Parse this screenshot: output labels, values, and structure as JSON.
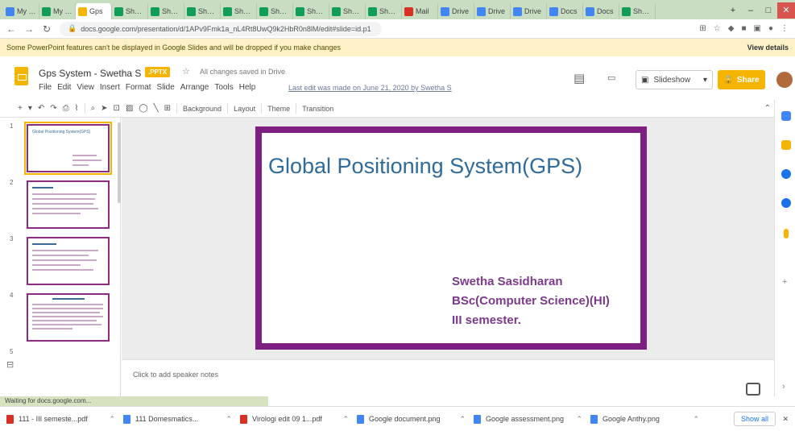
{
  "browser": {
    "tabs": [
      {
        "label": "My Drive",
        "color": "#4285f4"
      },
      {
        "label": "My Drive",
        "color": "#0f9d58"
      },
      {
        "label": "Gps",
        "color": "#f4b400",
        "active": true
      },
      {
        "label": "Sheets",
        "color": "#0f9d58"
      },
      {
        "label": "Sheets",
        "color": "#0f9d58"
      },
      {
        "label": "Sheets",
        "color": "#0f9d58"
      },
      {
        "label": "Sheets",
        "color": "#0f9d58"
      },
      {
        "label": "Sheets",
        "color": "#0f9d58"
      },
      {
        "label": "Sheets",
        "color": "#0f9d58"
      },
      {
        "label": "Sheets",
        "color": "#0f9d58"
      },
      {
        "label": "Sheets",
        "color": "#0f9d58"
      },
      {
        "label": "Mail",
        "color": "#d93025"
      },
      {
        "label": "Drive",
        "color": "#4285f4"
      },
      {
        "label": "Drive",
        "color": "#4285f4"
      },
      {
        "label": "Drive",
        "color": "#4285f4"
      },
      {
        "label": "Docs",
        "color": "#4285f4"
      },
      {
        "label": "Docs",
        "color": "#4285f4"
      },
      {
        "label": "Sheets",
        "color": "#0f9d58"
      }
    ],
    "new_tab": "+",
    "window_controls": [
      "–",
      "□",
      "✕"
    ],
    "url": "docs.google.com/presentation/d/1APv9Fmk1a_nL4Rt8UwQ9k2HbR0n8lM/edit#slide=id.p1"
  },
  "banner": {
    "message": "Some PowerPoint features can't be displayed in Google Slides and will be dropped if you make changes",
    "action": "View details"
  },
  "doc": {
    "title": "Gps System - Swetha S",
    "badge": ".PPTX",
    "saved": "All changes saved in Drive",
    "menu": [
      "File",
      "Edit",
      "View",
      "Insert",
      "Format",
      "Slide",
      "Arrange",
      "Tools",
      "Help"
    ],
    "last_edit": "Last edit was made on June 21, 2020 by Swetha S",
    "present_label": "Slideshow",
    "share_label": "Share"
  },
  "toolbar": {
    "background": "Background",
    "layout": "Layout",
    "theme": "Theme",
    "transition": "Transition"
  },
  "filmstrip": {
    "slides": [
      "1",
      "2",
      "3",
      "4",
      "5"
    ],
    "thumb1_title": "Global Positioning System(GPS)"
  },
  "slide": {
    "title": "Global Positioning System(GPS)",
    "author": "Swetha Sasidharan",
    "course": "BSc(Computer Science)(HI)",
    "semester": "III semester.",
    "border_color": "#7f1f84",
    "title_color": "#2f6b9a",
    "subtitle_color": "#7b3a8a"
  },
  "notes": {
    "placeholder": "Click to add speaker notes"
  },
  "status_tip": "Waiting for docs.google.com...",
  "downloads": {
    "items": [
      {
        "name": "111 - III semeste...pdf",
        "color": "#d93025"
      },
      {
        "name": "111 Domesmatics...",
        "color": "#4285f4"
      },
      {
        "name": "Virologi edit 09 1...pdf",
        "color": "#d93025"
      },
      {
        "name": "Google document.png",
        "color": "#4285f4"
      },
      {
        "name": "Google assessment.png",
        "color": "#4285f4"
      },
      {
        "name": "Google Anthy.png",
        "color": "#4285f4"
      }
    ],
    "show_all": "Show all"
  }
}
